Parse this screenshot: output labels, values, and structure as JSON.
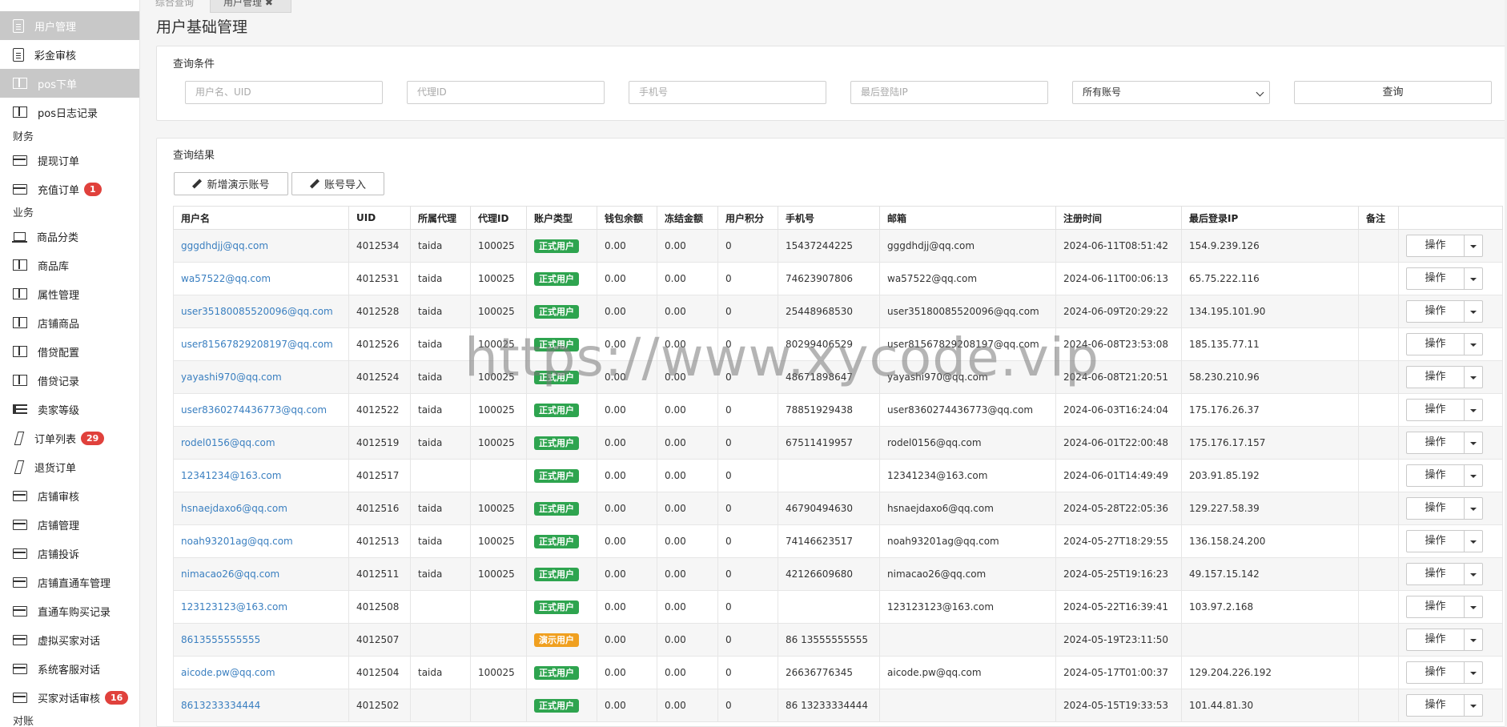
{
  "sidebar": {
    "items": [
      {
        "label": "用户管理",
        "icon": "doc-icon",
        "active": true
      },
      {
        "label": "彩金审核",
        "icon": "doc-icon",
        "active": false
      },
      {
        "label": "pos下单",
        "icon": "columns-icon",
        "active": true
      },
      {
        "label": "pos日志记录",
        "icon": "columns-icon",
        "active": false
      }
    ],
    "section_finance": "财务",
    "finance_items": [
      {
        "label": "提现订单",
        "icon": "card-icon",
        "badge": ""
      },
      {
        "label": "充值订单",
        "icon": "card-icon",
        "badge": "1"
      }
    ],
    "section_business": "业务",
    "business_items": [
      {
        "label": "商品分类",
        "icon": "laptop-icon",
        "badge": ""
      },
      {
        "label": "商品库",
        "icon": "columns-icon",
        "badge": ""
      },
      {
        "label": "属性管理",
        "icon": "columns-icon",
        "badge": ""
      },
      {
        "label": "店铺商品",
        "icon": "columns-icon",
        "badge": ""
      },
      {
        "label": "借贷配置",
        "icon": "columns-icon",
        "badge": ""
      },
      {
        "label": "借贷记录",
        "icon": "columns-icon",
        "badge": ""
      },
      {
        "label": "卖家等级",
        "icon": "list-icon",
        "badge": ""
      },
      {
        "label": "订单列表",
        "icon": "slash-icon",
        "badge": "29"
      },
      {
        "label": "退货订单",
        "icon": "slash-icon",
        "badge": ""
      },
      {
        "label": "店铺审核",
        "icon": "card-icon",
        "badge": ""
      },
      {
        "label": "店铺管理",
        "icon": "card-icon",
        "badge": ""
      },
      {
        "label": "店铺投诉",
        "icon": "card-icon",
        "badge": ""
      },
      {
        "label": "店铺直通车管理",
        "icon": "card-icon",
        "badge": ""
      },
      {
        "label": "直通车购买记录",
        "icon": "card-icon",
        "badge": ""
      },
      {
        "label": "虚拟买家对话",
        "icon": "card-icon",
        "badge": ""
      },
      {
        "label": "系统客服对话",
        "icon": "card-icon",
        "badge": ""
      },
      {
        "label": "买家对话审核",
        "icon": "card-icon",
        "badge": "16"
      }
    ],
    "section_bottom": "对账"
  },
  "tabs": {
    "inactive": "综合查询",
    "active": "用户管理 ✖"
  },
  "page_title": "用户基础管理",
  "query": {
    "title": "查询条件",
    "username_placeholder": "用户名、UID",
    "agent_placeholder": "代理ID",
    "phone_placeholder": "手机号",
    "ip_placeholder": "最后登陆IP",
    "account_select": "所有账号",
    "query_button": "查询"
  },
  "results": {
    "title": "查询结果",
    "add_demo_button": "新增演示账号",
    "import_button": "账号导入",
    "columns": [
      "用户名",
      "UID",
      "所属代理",
      "代理ID",
      "账户类型",
      "钱包余额",
      "冻结金额",
      "用户积分",
      "手机号",
      "邮箱",
      "注册时间",
      "最后登录IP",
      "备注",
      ""
    ],
    "op_label": "操作",
    "tag_colors": {
      "正式用户": "#2ea44f",
      "演示用户": "#f0a020"
    },
    "rows": [
      [
        "gggdhdjj@qq.com",
        "4012534",
        "taida",
        "100025",
        "正式用户",
        "0.00",
        "0.00",
        "0",
        "15437244225",
        "gggdhdjj@qq.com",
        "2024-06-11T08:51:42",
        "154.9.239.126",
        ""
      ],
      [
        "wa57522@qq.com",
        "4012531",
        "taida",
        "100025",
        "正式用户",
        "0.00",
        "0.00",
        "0",
        "74623907806",
        "wa57522@qq.com",
        "2024-06-11T00:06:13",
        "65.75.222.116",
        ""
      ],
      [
        "user35180085520096@qq.com",
        "4012528",
        "taida",
        "100025",
        "正式用户",
        "0.00",
        "0.00",
        "0",
        "25448968530",
        "user35180085520096@qq.com",
        "2024-06-09T20:29:22",
        "134.195.101.90",
        ""
      ],
      [
        "user81567829208197@qq.com",
        "4012526",
        "taida",
        "100025",
        "正式用户",
        "0.00",
        "0.00",
        "0",
        "80299406529",
        "user81567829208197@qq.com",
        "2024-06-08T23:53:08",
        "185.135.77.11",
        ""
      ],
      [
        "yayashi970@qq.com",
        "4012524",
        "taida",
        "100025",
        "正式用户",
        "0.00",
        "0.00",
        "0",
        "48671898647",
        "yayashi970@qq.com",
        "2024-06-08T21:20:51",
        "58.230.210.96",
        ""
      ],
      [
        "user8360274436773@qq.com",
        "4012522",
        "taida",
        "100025",
        "正式用户",
        "0.00",
        "0.00",
        "0",
        "78851929438",
        "user8360274436773@qq.com",
        "2024-06-03T16:24:04",
        "175.176.26.37",
        ""
      ],
      [
        "rodel0156@qq.com",
        "4012519",
        "taida",
        "100025",
        "正式用户",
        "0.00",
        "0.00",
        "0",
        "67511419957",
        "rodel0156@qq.com",
        "2024-06-01T22:00:48",
        "175.176.17.157",
        ""
      ],
      [
        "12341234@163.com",
        "4012517",
        "",
        "",
        "正式用户",
        "0.00",
        "0.00",
        "0",
        "",
        "12341234@163.com",
        "2024-06-01T14:49:49",
        "203.91.85.192",
        ""
      ],
      [
        "hsnaejdaxo6@qq.com",
        "4012516",
        "taida",
        "100025",
        "正式用户",
        "0.00",
        "0.00",
        "0",
        "46790494630",
        "hsnaejdaxo6@qq.com",
        "2024-05-28T22:05:36",
        "129.227.58.39",
        ""
      ],
      [
        "noah93201ag@qq.com",
        "4012513",
        "taida",
        "100025",
        "正式用户",
        "0.00",
        "0.00",
        "0",
        "74146623517",
        "noah93201ag@qq.com",
        "2024-05-27T18:29:55",
        "136.158.24.200",
        ""
      ],
      [
        "nimacao26@qq.com",
        "4012511",
        "taida",
        "100025",
        "正式用户",
        "0.00",
        "0.00",
        "0",
        "42126609680",
        "nimacao26@qq.com",
        "2024-05-25T19:16:23",
        "49.157.15.142",
        ""
      ],
      [
        "123123123@163.com",
        "4012508",
        "",
        "",
        "正式用户",
        "0.00",
        "0.00",
        "0",
        "",
        "123123123@163.com",
        "2024-05-22T16:39:41",
        "103.97.2.168",
        ""
      ],
      [
        "8613555555555",
        "4012507",
        "",
        "",
        "演示用户",
        "0.00",
        "0.00",
        "0",
        "86 13555555555",
        "",
        "2024-05-19T23:11:50",
        "",
        ""
      ],
      [
        "aicode.pw@qq.com",
        "4012504",
        "taida",
        "100025",
        "正式用户",
        "0.00",
        "0.00",
        "0",
        "26636776345",
        "aicode.pw@qq.com",
        "2024-05-17T01:00:37",
        "129.204.226.192",
        ""
      ],
      [
        "8613233334444",
        "4012502",
        "",
        "",
        "正式用户",
        "0.00",
        "0.00",
        "0",
        "86 13233334444",
        "",
        "2024-05-15T19:33:53",
        "101.44.81.30",
        ""
      ]
    ]
  },
  "watermark": "https://www.xycode.vip"
}
